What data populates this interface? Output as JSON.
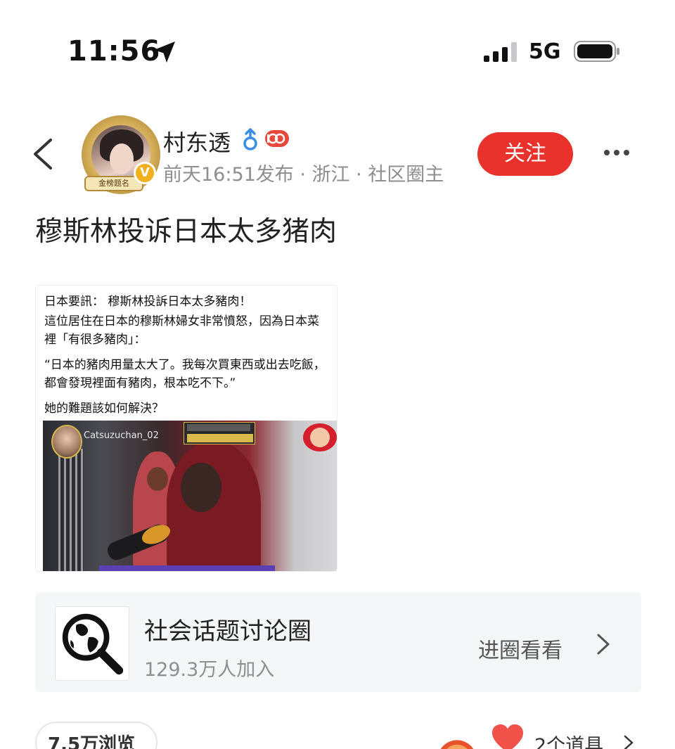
{
  "status_bar": {
    "time": "11:56",
    "network": "5G",
    "icons": [
      "location-arrow-icon",
      "signal-icon",
      "battery-icon"
    ]
  },
  "header": {
    "username": "村东透",
    "gender_symbol": "♂",
    "avatar_ribbon_text": "金榜题名",
    "verified_symbol": "V",
    "post_meta": "前天16:51发布 · 浙江 · 社区圈主",
    "follow_label": "关注",
    "icons": [
      "back-icon",
      "more-icon",
      "level-badge-icon"
    ]
  },
  "post": {
    "title": "穆斯林投诉日本太多猪肉",
    "image_text": {
      "line1": "日本要訊：  穆斯林投訴日本太多豬肉！",
      "line2": "這位居住在日本的穆斯林婦女非常憤怒，因為日本菜",
      "line3": "裡「有很多豬肉」：",
      "line4": "“日本的豬肉用量太大了。我每次買東西或出去吃飯，",
      "line5": "都會發現裡面有豬肉，根本吃不下。”",
      "line6": "她的難題該如何解決？",
      "watermark": "Catsuzuchan_02"
    }
  },
  "circle": {
    "name": "社会话题讨论圈",
    "members": "129.3万人加入",
    "enter_label": "进圈看看",
    "icon": "globe-magnifier-icon"
  },
  "footer": {
    "views": "7.5万浏览",
    "props": "2个道具"
  },
  "colors": {
    "accent_red": "#e8322b",
    "meta_gray": "#8e8e93",
    "card_bg": "#f5f6f8",
    "verified_gold": "#f2b01e"
  }
}
